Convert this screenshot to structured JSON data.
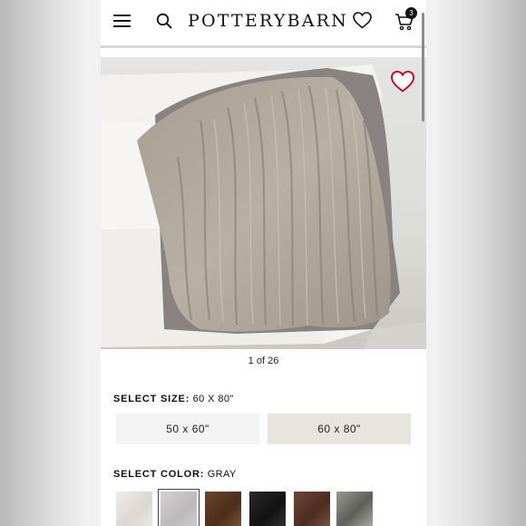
{
  "header": {
    "brand": "POTTERYBARN",
    "cart_count": "3"
  },
  "gallery": {
    "pager_text": "1 of 26"
  },
  "size": {
    "label": "SELECT SIZE:",
    "selected": "60 X 80\"",
    "options": [
      "50 x 60\"",
      "60 x 80\""
    ]
  },
  "color": {
    "label": "SELECT COLOR:",
    "selected": "GRAY",
    "swatches": [
      {
        "name": "ivory-swatch",
        "hex": "#e7e4de"
      },
      {
        "name": "gray-swatch",
        "hex": "#c9c6c8"
      },
      {
        "name": "brown-swatch",
        "hex": "#5a3a24"
      },
      {
        "name": "black-swatch",
        "hex": "#1c1c1c"
      },
      {
        "name": "mink-swatch",
        "hex": "#5b3b2c"
      },
      {
        "name": "wolf-swatch",
        "hex": "#7d7d7a"
      }
    ]
  },
  "colors": {
    "selected_size_bg": "#e8e5de",
    "unselected_size_bg": "#f3f3f3",
    "heart_accent": "#c8102e"
  }
}
